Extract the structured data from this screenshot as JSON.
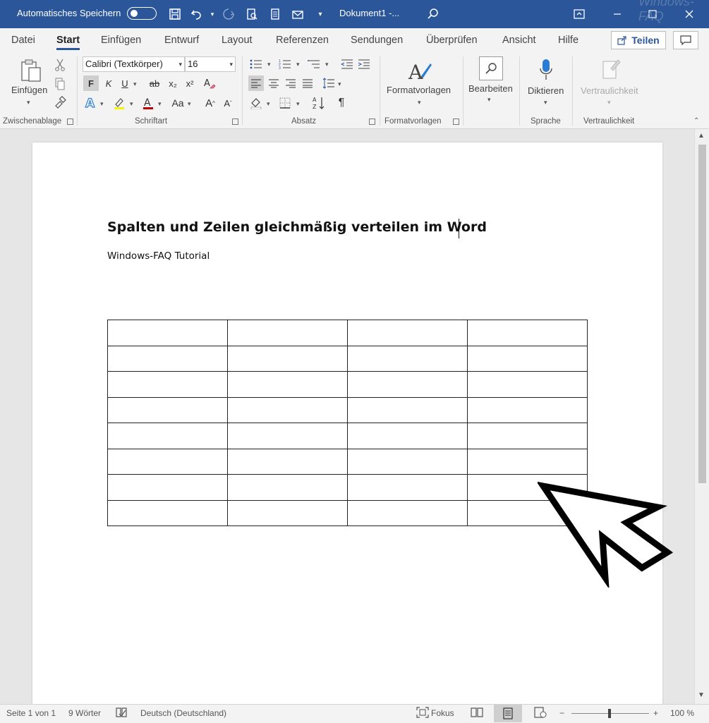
{
  "titlebar": {
    "autosave_label": "Automatisches Speichern",
    "document_title": "Dokument1  -...",
    "watermark": "Windows-FAQ"
  },
  "tabs": [
    "Datei",
    "Start",
    "Einfügen",
    "Entwurf",
    "Layout",
    "Referenzen",
    "Sendungen",
    "Überprüfen",
    "Ansicht",
    "Hilfe"
  ],
  "active_tab": "Start",
  "share_label": "Teilen",
  "ribbon": {
    "paste_label": "Einfügen",
    "font_name": "Calibri (Textkörper)",
    "font_size": "16",
    "bold_glyph": "F",
    "italic_glyph": "K",
    "underline_glyph": "U",
    "strike_glyph": "ab",
    "subscript_glyph": "x₂",
    "superscript_glyph": "x²",
    "styles_label": "Formatvorlagen",
    "edit_label": "Bearbeiten",
    "dictate_label": "Diktieren",
    "sensitivity_label": "Vertraulichkeit",
    "groups": {
      "clipboard": "Zwischenablage",
      "font": "Schriftart",
      "paragraph": "Absatz",
      "styles": "Formatvorlagen",
      "voice": "Sprache",
      "sensitivity": "Vertraulichkeit"
    }
  },
  "document": {
    "heading": "Spalten und Zeilen gleichmäßig verteilen im Word",
    "subtitle": "Windows-FAQ Tutorial",
    "table_rows": 8,
    "table_cols": 4
  },
  "status": {
    "page": "Seite 1 von 1",
    "words": "9 Wörter",
    "language": "Deutsch (Deutschland)",
    "focus": "Fokus",
    "zoom": "100 %",
    "zoom_minus": "−",
    "zoom_plus": "+"
  },
  "colors": {
    "titlebar": "#2b579a",
    "ribbon_bg": "#f3f3f3",
    "doc_bg": "#e6e6e6"
  }
}
